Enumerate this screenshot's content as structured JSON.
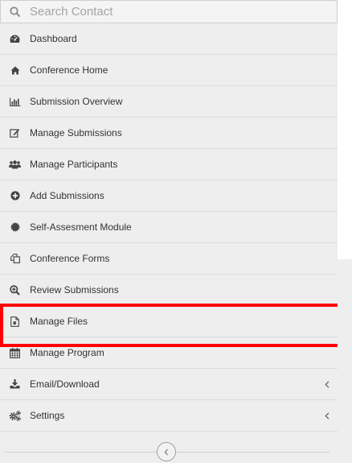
{
  "search": {
    "placeholder": "Search Contact",
    "icon": "search-icon"
  },
  "menu": {
    "items": [
      {
        "label": "Dashboard",
        "icon": "dashboard-icon"
      },
      {
        "label": "Conference Home",
        "icon": "home-icon"
      },
      {
        "label": "Submission Overview",
        "icon": "bar-chart-icon"
      },
      {
        "label": "Manage Submissions",
        "icon": "edit-icon"
      },
      {
        "label": "Manage Participants",
        "icon": "users-icon"
      },
      {
        "label": "Add Submissions",
        "icon": "plus-circle-icon"
      },
      {
        "label": "Self-Assesment Module",
        "icon": "certificate-icon"
      },
      {
        "label": "Conference Forms",
        "icon": "copy-icon"
      },
      {
        "label": "Review Submissions",
        "icon": "search-plus-icon"
      },
      {
        "label": "Manage Files",
        "icon": "file-icon",
        "highlighted": true
      },
      {
        "label": "Manage Program",
        "icon": "calendar-icon"
      },
      {
        "label": "Email/Download",
        "icon": "download-icon",
        "expandable": true
      },
      {
        "label": "Settings",
        "icon": "gears-icon",
        "expandable": true
      }
    ]
  },
  "colors": {
    "highlight": "#ff0000",
    "sidebar_bg": "#eeeeee",
    "text": "#333333"
  },
  "collapse": {
    "icon": "chevron-left-icon"
  }
}
